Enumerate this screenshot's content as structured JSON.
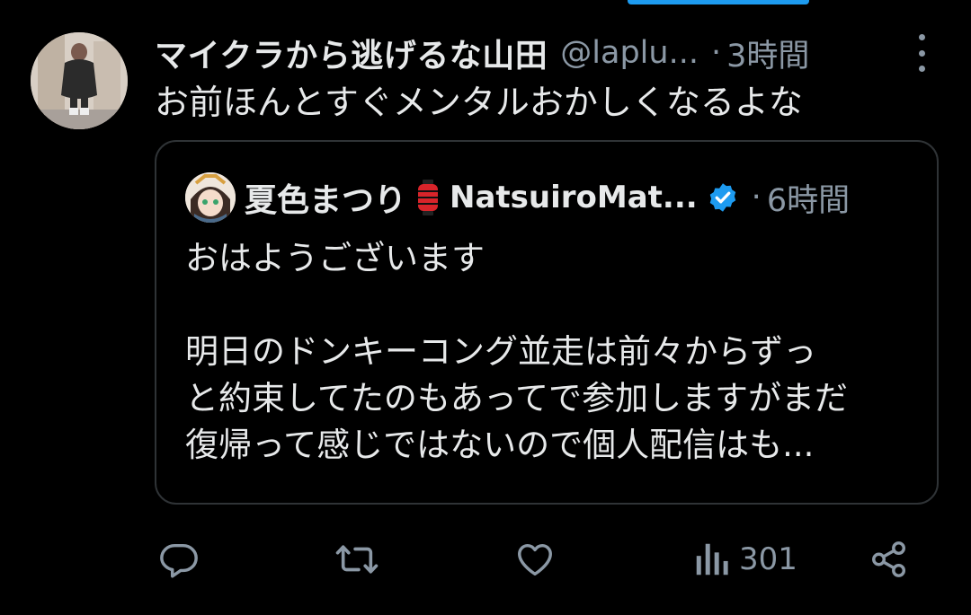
{
  "tweet": {
    "author_name": "マイクラから逃げるな山田",
    "author_handle": "@laplu...",
    "separator": "·",
    "time": "3時間",
    "text": "お前ほんとすぐメンタルおかしくなるよな"
  },
  "quoted_tweet": {
    "author_name": "夏色まつり",
    "author_emoji": "lantern-icon",
    "author_handle": "NatsuiroMat...",
    "verified": true,
    "separator": "·",
    "time": "6時間",
    "lines": [
      "おはようございます",
      "",
      "明日のドンキーコング並走は前々からずっ",
      "と約束してたのもあってで参加しますがまだ",
      "復帰って感じではないので個人配信はも..."
    ]
  },
  "actions": {
    "reply_icon": "reply-icon",
    "retweet_icon": "retweet-icon",
    "like_icon": "like-icon",
    "views_icon": "views-icon",
    "views_count": "301",
    "share_icon": "share-icon"
  },
  "colors": {
    "background": "#000000",
    "text": "#e7e9ea",
    "muted": "#8b98a5",
    "border": "#2f3336",
    "accent": "#1d9bf0"
  }
}
